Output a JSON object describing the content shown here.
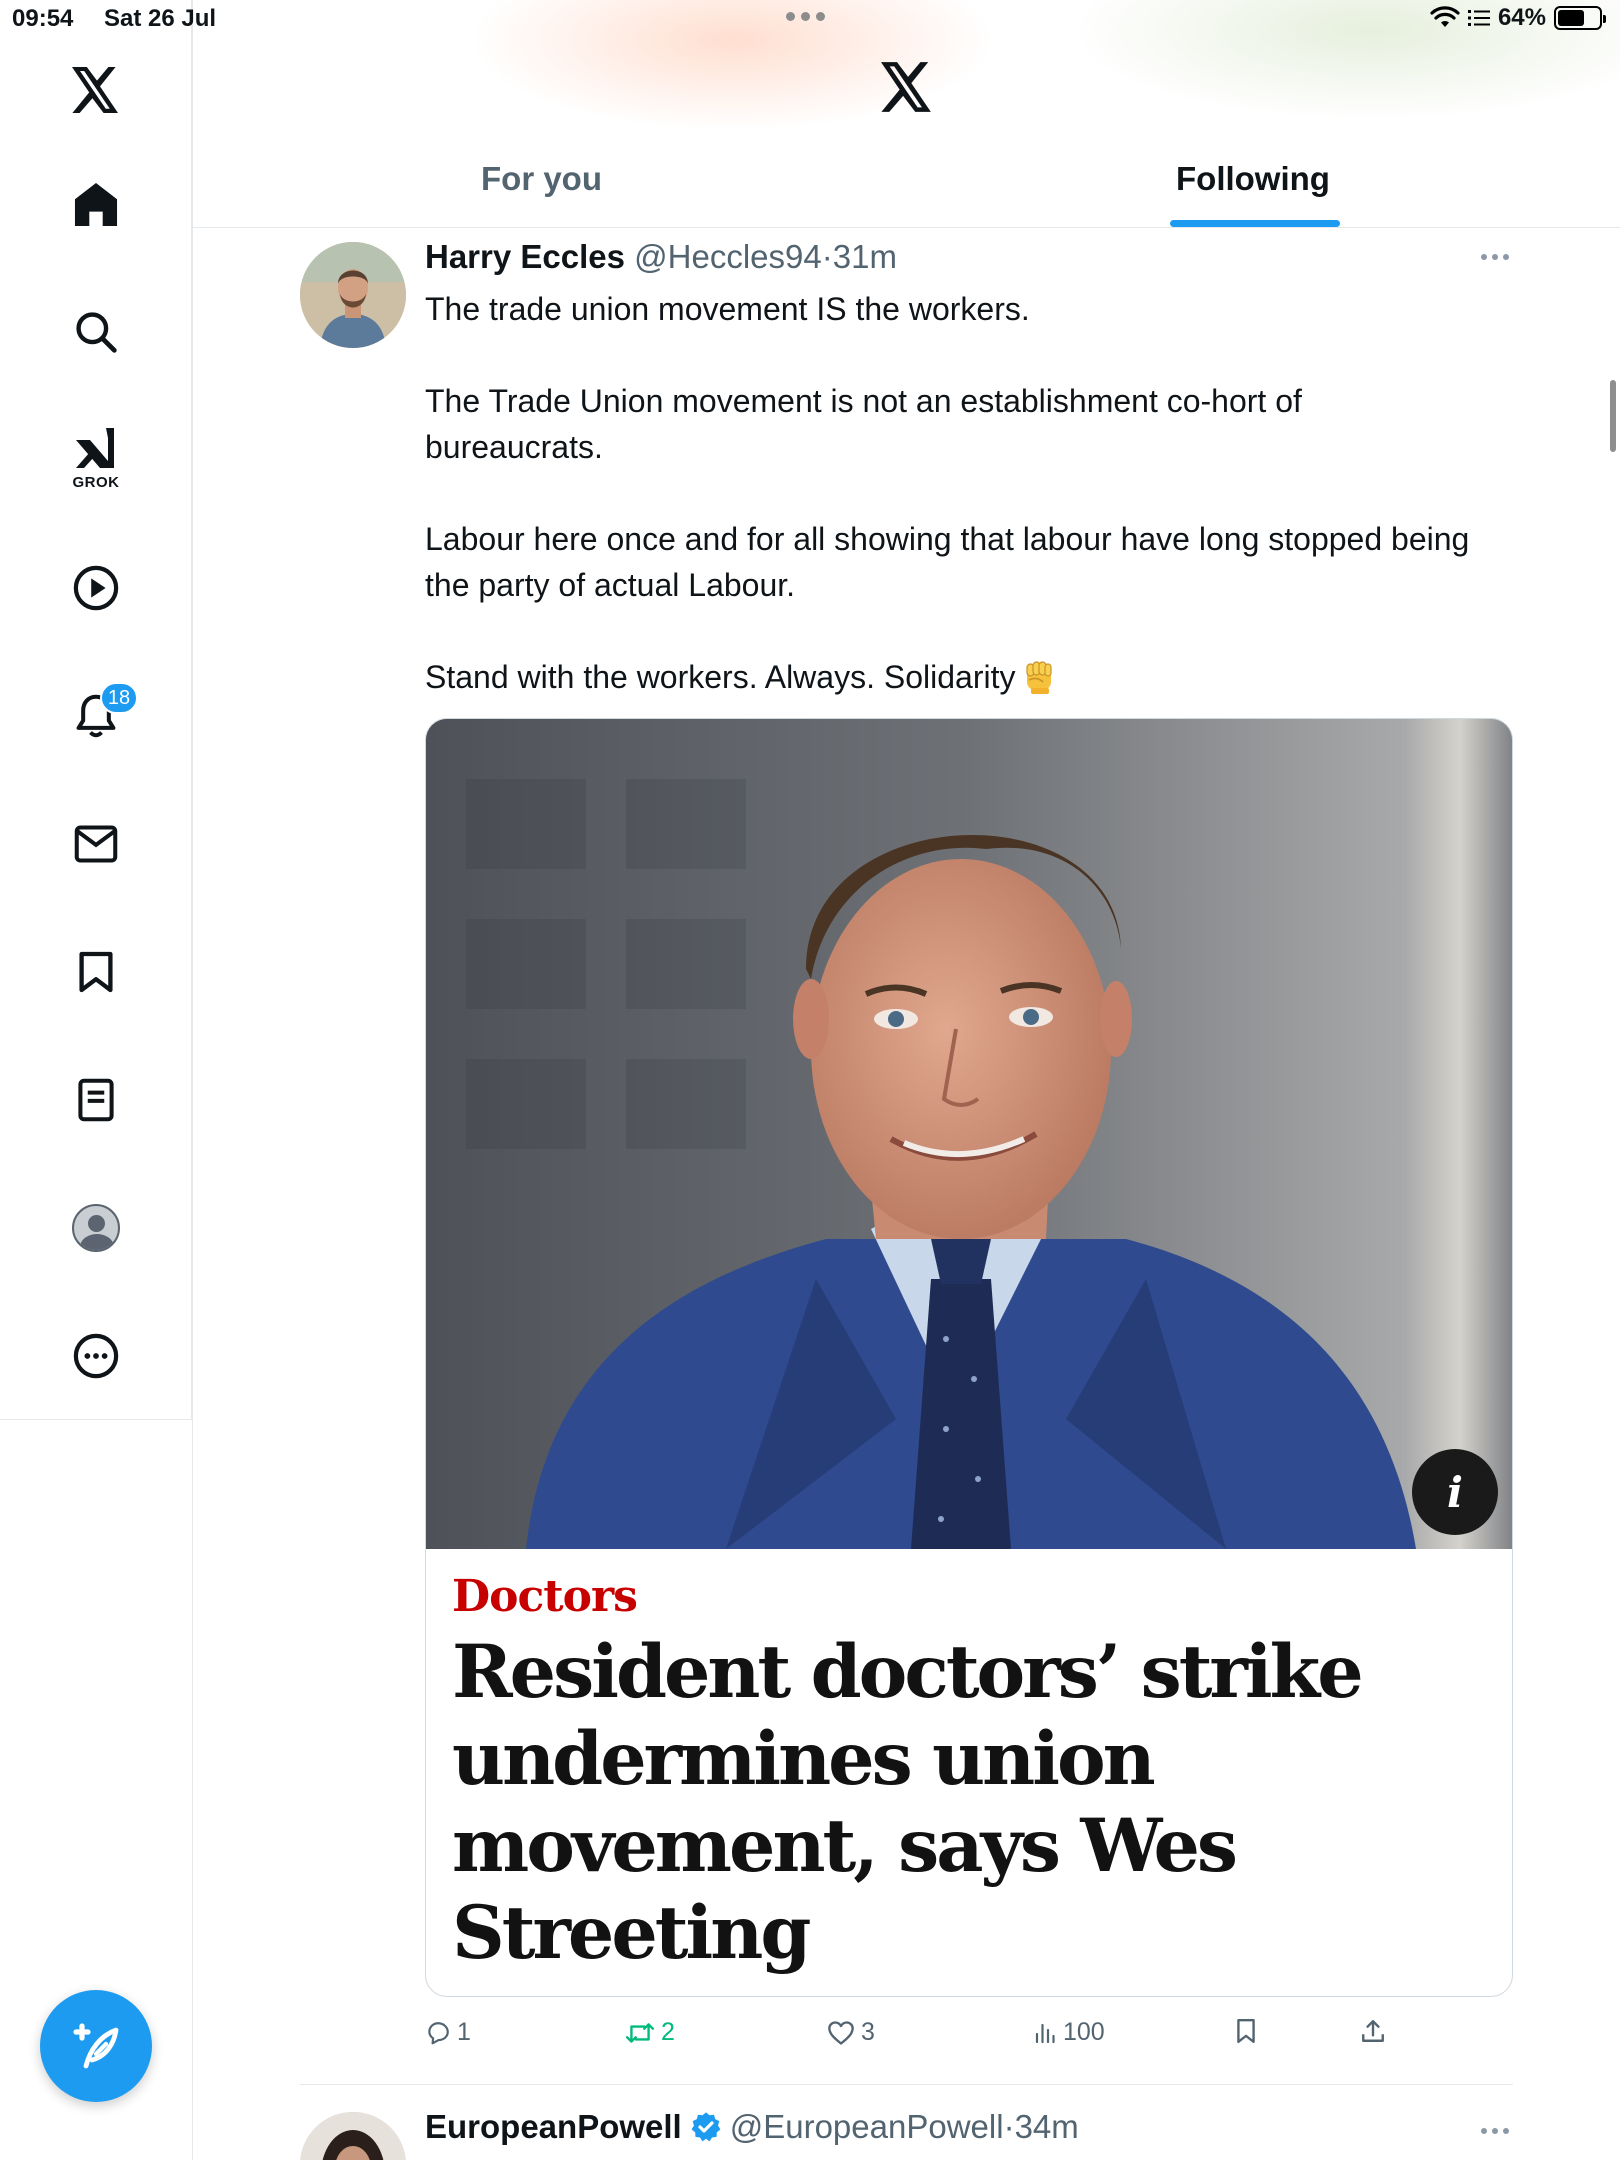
{
  "status_bar": {
    "time": "09:54",
    "date": "Sat 26 Jul",
    "battery_text": "64%",
    "battery_level": 0.64
  },
  "sidebar": {
    "items": [
      {
        "name": "home",
        "icon": "home-icon"
      },
      {
        "name": "explore",
        "icon": "search-icon"
      },
      {
        "name": "grok",
        "icon": "grok-icon",
        "label": "GROK"
      },
      {
        "name": "videos",
        "icon": "play-icon"
      },
      {
        "name": "notifications",
        "icon": "bell-icon",
        "badge": "18"
      },
      {
        "name": "messages",
        "icon": "mail-icon"
      },
      {
        "name": "bookmarks",
        "icon": "bookmark-icon"
      },
      {
        "name": "lists",
        "icon": "list-icon"
      },
      {
        "name": "profile",
        "icon": "avatar-icon"
      },
      {
        "name": "more",
        "icon": "more-circle-icon"
      }
    ],
    "compose_icon": "compose-feather-icon"
  },
  "header": {
    "tabs": [
      {
        "label": "For you",
        "active": false
      },
      {
        "label": "Following",
        "active": true
      }
    ],
    "accent": "#1d9bf0"
  },
  "tweet": {
    "name": "Harry Eccles",
    "handle": "@Heccles94",
    "separator": "·",
    "time": "31m",
    "paragraphs": [
      "The trade union movement IS the workers.",
      "The Trade Union movement is not an establishment co-hort of bureaucrats.",
      "Labour here once and for all showing that labour have long stopped being the party of actual Labour.",
      "Stand with the workers. Always. Solidarity"
    ],
    "card": {
      "kicker": "Doctors",
      "headline": "Resident doctors’ strike undermines union movement, says Wes Streeting",
      "info_icon": "i",
      "kicker_color": "#c70000"
    },
    "actions": {
      "replies": "1",
      "reposts": "2",
      "likes": "3",
      "views": "100"
    }
  },
  "tweet2": {
    "name": "EuropeanPowell",
    "handle": "@EuropeanPowell",
    "separator": "·",
    "time": "34m"
  }
}
